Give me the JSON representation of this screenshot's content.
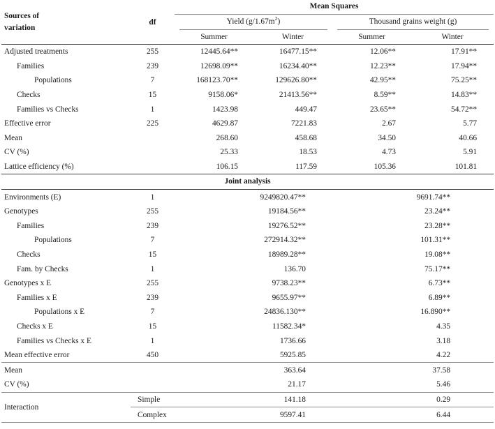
{
  "header": {
    "stub_line1": "Sources of",
    "stub_line2": "variation",
    "df": "df",
    "mean_squares": "Mean Squares",
    "group_yield_pre": "Yield (g/1.67m",
    "group_yield_sup": "2",
    "group_yield_post": ")",
    "group_weight": "Thousand grains weight (g)",
    "season_summer_yield": "Summer",
    "season_winter_yield": "Winter",
    "season_summer_weight": "Summer",
    "season_winter_weight": "Winter"
  },
  "banner": {
    "joint": "Joint analysis"
  },
  "interaction": {
    "label": "Interaction",
    "simple": "Simple",
    "complex": "Complex"
  },
  "individual_rows": [
    {
      "source": "Adjusted treatments",
      "indent": 0,
      "df": "255",
      "yield_summer": "12445.64**",
      "yield_winter": "16477.15**",
      "weight_summer": "12.06**",
      "weight_winter": "17.91**"
    },
    {
      "source": "Families",
      "indent": 1,
      "df": "239",
      "yield_summer": "12698.09**",
      "yield_winter": "16234.40**",
      "weight_summer": "12.23**",
      "weight_winter": "17.94**"
    },
    {
      "source": "Populations",
      "indent": 2,
      "df": "7",
      "yield_summer": "168123.70**",
      "yield_winter": "129626.80**",
      "weight_summer": "42.95**",
      "weight_winter": "75.25**"
    },
    {
      "source": "Checks",
      "indent": 1,
      "df": "15",
      "yield_summer": "9158.06*",
      "yield_winter": "21413.56**",
      "weight_summer": "8.59**",
      "weight_winter": "14.83**"
    },
    {
      "source": "Families vs Checks",
      "indent": 1,
      "df": "1",
      "yield_summer": "1423.98",
      "yield_winter": "449.47",
      "weight_summer": "23.65**",
      "weight_winter": "54.72**"
    },
    {
      "source": "Effective error",
      "indent": 0,
      "df": "225",
      "yield_summer": "4629.87",
      "yield_winter": "7221.83",
      "weight_summer": "2.67",
      "weight_winter": "5.77"
    },
    {
      "source": "Mean",
      "indent": 0,
      "df": "",
      "yield_summer": "268.60",
      "yield_winter": "458.68",
      "weight_summer": "34.50",
      "weight_winter": "40.66"
    },
    {
      "source": "CV (%)",
      "indent": 0,
      "df": "",
      "yield_summer": "25.33",
      "yield_winter": "18.53",
      "weight_summer": "4.73",
      "weight_winter": "5.91"
    },
    {
      "source": "Lattice efficiency (%)",
      "indent": 0,
      "df": "",
      "yield_summer": "106.15",
      "yield_winter": "117.59",
      "weight_summer": "105.36",
      "weight_winter": "101.81"
    }
  ],
  "joint_rows": [
    {
      "source": "Environments (E)",
      "indent": 0,
      "df": "1",
      "yield": "9249820.47**",
      "weight": "9691.74**"
    },
    {
      "source": "Genotypes",
      "indent": 0,
      "df": "255",
      "yield": "19184.56**",
      "weight": "23.24**"
    },
    {
      "source": "Families",
      "indent": 1,
      "df": "239",
      "yield": "19276.52**",
      "weight": "23.28**"
    },
    {
      "source": "Populations",
      "indent": 2,
      "df": "7",
      "yield": "272914.32**",
      "weight": "101.31**"
    },
    {
      "source": "Checks",
      "indent": 1,
      "df": "15",
      "yield": "18989.28**",
      "weight": "19.08**"
    },
    {
      "source": "Fam. by Checks",
      "indent": 1,
      "df": "1",
      "yield": "136.70",
      "weight": "75.17**"
    },
    {
      "source": "Genotypes x E",
      "indent": 0,
      "df": "255",
      "yield": "9738.23**",
      "weight": "6.73**"
    },
    {
      "source": "Families x E",
      "indent": 1,
      "df": "239",
      "yield": "9655.97**",
      "weight": "6.89**"
    },
    {
      "source": "Populations x E",
      "indent": 2,
      "df": "7",
      "yield": "24836.130**",
      "weight": "16.890**"
    },
    {
      "source": "Checks x E",
      "indent": 1,
      "df": "15",
      "yield": "11582.34*",
      "weight": "4.35"
    },
    {
      "source": "Families vs Checks x E",
      "indent": 1,
      "df": "1",
      "yield": "1736.66",
      "weight": "3.18"
    },
    {
      "source": "Mean effective error",
      "indent": 0,
      "df": "450",
      "yield": "5925.85",
      "weight": "4.22"
    }
  ],
  "joint_summary_rows": [
    {
      "source": "Mean",
      "yield": "363.64",
      "weight": "37.58"
    },
    {
      "source": "CV (%)",
      "yield": "21.17",
      "weight": "5.46"
    }
  ],
  "interaction_rows": [
    {
      "kind": "Simple",
      "yield": "141.18",
      "weight": "0.29"
    },
    {
      "kind": "Complex",
      "yield": "9597.41",
      "weight": "6.44"
    }
  ]
}
